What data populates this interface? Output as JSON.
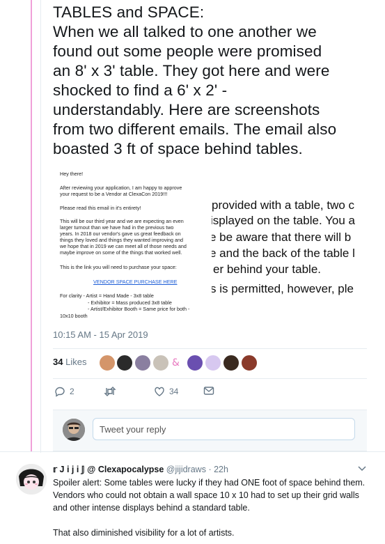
{
  "tweet": {
    "lines": [
      "TABLES and SPACE:",
      "When we all talked to one another we",
      "found out some people were promised",
      "an 8' x 3' table. They got here and were",
      "shocked to find a 6' x 2' -",
      "understandably. Here are screenshots",
      "from two different emails. The email also",
      "boasted 3 ft of space behind tables."
    ],
    "timestamp": "10:15 AM - 15 Apr 2019",
    "likes_count": "34",
    "likes_label": "Likes",
    "reply_count": "2",
    "like_count": "34"
  },
  "email1": {
    "greeting": "Hey there!",
    "p1_l1": "After reviewing your application, I am happy to approve",
    "p1_l2": "your request to be a Vendor at ClexaCon 2019!!!",
    "p2": "Please read this email in it's entirety!",
    "p3_l1": "This will be our third year and we are expecting an even",
    "p3_l2": "larger turnout than we have had in the previous two",
    "p3_l3": "years. In 2018 our vendor's gave us great feedback on",
    "p3_l4": "things they loved and things they wanted improving and",
    "p3_l5": "we hope that in 2019 we can meet all of those needs and",
    "p3_l6": "maybe improve on some of the things that worked well.",
    "p4": "This is the link you will need to purchase your space:",
    "link": "VENDOR SPACE PURCHASE HERE",
    "c1": "For clarity - Artist = Hand Made - 3x8 table",
    "c2": "- Exhibitor = Mass produced 3x8 table",
    "c3": "- Artist/Exhibitor Booth = Same price for both -",
    "c4": "10x10 booth"
  },
  "email2": {
    "l1": "provided with a table, two c",
    "l2": "isplayed on the table. You a",
    "l3": "e be aware that there will b",
    "l4": "e and the back of the table l",
    "l5": "er  behind your table.",
    "l6": "s is permitted, however, ple"
  },
  "reply": {
    "input_placeholder": "Tweet your reply"
  },
  "reply_tweet": {
    "name": "𝕣 J i j i 𝕁 @ Clexapocalypse",
    "handle": "@jijidraws",
    "time": "· 22h",
    "lines": [
      "Spoiler alert: Some tables were lucky if they had ONE foot of space behind them.",
      "Vendors who could not obtain a wall space 10 x 10 had to set up their grid walls",
      "and other intense displays behind a standard table.",
      "",
      "That also diminished visibility for a lot of artists."
    ]
  },
  "colors": {
    "thread_line": "#f0a0d8",
    "accent": "#1da1f2",
    "meta": "#657786"
  }
}
